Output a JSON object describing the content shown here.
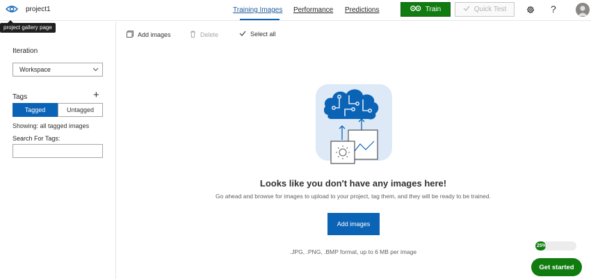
{
  "header": {
    "project_name": "project1",
    "tooltip": "project gallery page",
    "tabs": [
      {
        "label": "Training Images",
        "active": true
      },
      {
        "label": "Performance",
        "active": false
      },
      {
        "label": "Predictions",
        "active": false
      }
    ],
    "train_label": "Train",
    "quick_test_label": "Quick Test",
    "help_glyph": "?",
    "icons": {
      "gallery": "eye-icon",
      "train": "gears-icon",
      "quick_test": "check-icon",
      "settings": "gear-icon",
      "account": "avatar-icon"
    }
  },
  "sidebar": {
    "iteration_label": "Iteration",
    "iteration_value": "Workspace",
    "tags_label": "Tags",
    "add_tag_glyph": "+",
    "tag_toggle": {
      "tagged": "Tagged",
      "untagged": "Untagged",
      "selected": "Tagged"
    },
    "showing_text": "Showing: all tagged images",
    "search_label": "Search For Tags:",
    "search_value": ""
  },
  "toolbar": {
    "add_images": "Add images",
    "delete": "Delete",
    "select_all": "Select all"
  },
  "empty_state": {
    "title": "Looks like you don't have any images here!",
    "description": "Go ahead and browse for images to upload to your project, tag them, and they will be ready to be trained.",
    "button_label": "Add images",
    "formats": ".JPG, .PNG, .BMP format, up to 6 MB per image"
  },
  "onboarding": {
    "progress_percent": 25,
    "progress_label": "25%",
    "get_started_label": "Get started"
  },
  "colors": {
    "accent_blue": "#0b63b6",
    "train_green": "#107c10",
    "illustration_bg": "#dde9f7"
  }
}
